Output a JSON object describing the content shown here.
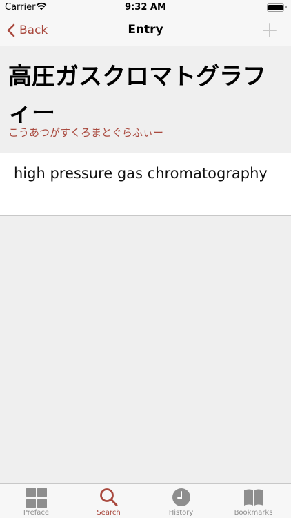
{
  "status_bar": {
    "carrier": "Carrier",
    "time": "9:32 AM"
  },
  "nav": {
    "back_label": "Back",
    "title": "Entry",
    "add_icon": "plus-icon"
  },
  "entry": {
    "headword": "高圧ガスクロマトグラフィー",
    "reading": "こうあつがすくろまとぐらふぃー",
    "definition": "high pressure gas chromatography"
  },
  "tabs": [
    {
      "label": "Preface",
      "icon": "grid-icon",
      "active": false
    },
    {
      "label": "Search",
      "icon": "search-icon",
      "active": true
    },
    {
      "label": "History",
      "icon": "clock-icon",
      "active": false
    },
    {
      "label": "Bookmarks",
      "icon": "book-icon",
      "active": false
    }
  ],
  "colors": {
    "accent": "#a9493e",
    "inactive": "#8e8e8e",
    "background": "#efefef"
  }
}
